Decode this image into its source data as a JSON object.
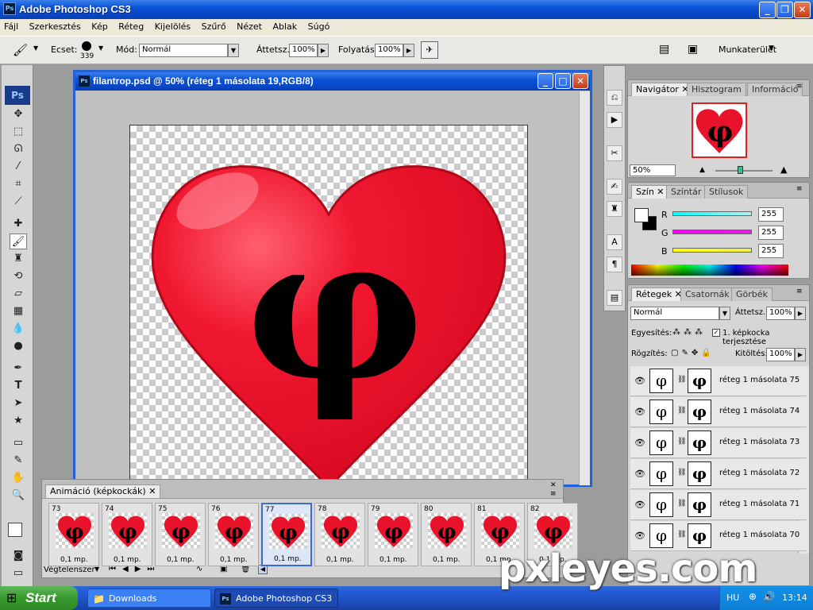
{
  "app": {
    "title": "Adobe Photoshop CS3",
    "logo": "Ps"
  },
  "menu": [
    "Fájl",
    "Szerkesztés",
    "Kép",
    "Réteg",
    "Kijelölés",
    "Szűrő",
    "Nézet",
    "Ablak",
    "Súgó"
  ],
  "options": {
    "brush_label": "Ecset:",
    "brush_size": "339",
    "mode_label": "Mód:",
    "mode_value": "Normál",
    "opacity_label": "Áttetsz.:",
    "opacity_value": "100%",
    "flow_label": "Folyatás:",
    "flow_value": "100%",
    "workspace_label": "Munkaterület"
  },
  "document": {
    "title": "filantrop.psd @ 50% (réteg 1 másolata 19,RGB/8)",
    "heart_color": "#e8122a",
    "glyph": "φ"
  },
  "navigator": {
    "tabs": [
      "Navigátor",
      "Hisztogram",
      "Információ"
    ],
    "zoom": "50%"
  },
  "color_panel": {
    "tabs": [
      "Szín",
      "Színtár",
      "Stílusok"
    ],
    "channels": [
      {
        "label": "R",
        "value": "255",
        "color": "#00c8d8"
      },
      {
        "label": "G",
        "value": "255",
        "color": "#e000e0"
      },
      {
        "label": "B",
        "value": "255",
        "color": "#e0e000"
      }
    ]
  },
  "layers_panel": {
    "tabs": [
      "Rétegek",
      "Csatornák",
      "Görbék"
    ],
    "blend_mode": "Normál",
    "opacity_label": "Áttetsz.:",
    "opacity_value": "100%",
    "unify_label": "Egyesítés:",
    "propagate_label": "1. képkocka terjesztése",
    "lock_label": "Rögzítés:",
    "fill_label": "Kitöltés:",
    "fill_value": "100%",
    "layers": [
      {
        "name": "réteg 1 másolata 75"
      },
      {
        "name": "réteg 1 másolata 74"
      },
      {
        "name": "réteg 1 másolata 73"
      },
      {
        "name": "réteg 1 másolata 72"
      },
      {
        "name": "réteg 1 másolata 71"
      },
      {
        "name": "réteg 1 másolata 70"
      }
    ]
  },
  "animation": {
    "tab": "Animáció (képkockák)",
    "loop": "Végtelenszer",
    "frames": [
      {
        "num": "73",
        "delay": "0,1 mp."
      },
      {
        "num": "74",
        "delay": "0,1 mp."
      },
      {
        "num": "75",
        "delay": "0,1 mp."
      },
      {
        "num": "76",
        "delay": "0,1 mp."
      },
      {
        "num": "77",
        "delay": "0,1 mp."
      },
      {
        "num": "78",
        "delay": "0,1 mp."
      },
      {
        "num": "79",
        "delay": "0,1 mp."
      },
      {
        "num": "80",
        "delay": "0,1 mp."
      },
      {
        "num": "81",
        "delay": "0,1 mp."
      },
      {
        "num": "82",
        "delay": "0,1 mp."
      }
    ],
    "selected_frame": "77"
  },
  "taskbar": {
    "start": "Start",
    "tasks": [
      {
        "label": "Downloads"
      },
      {
        "label": "Adobe Photoshop CS3"
      }
    ],
    "lang": "HU",
    "time": "13:14"
  },
  "watermark": "pxleyes.com"
}
